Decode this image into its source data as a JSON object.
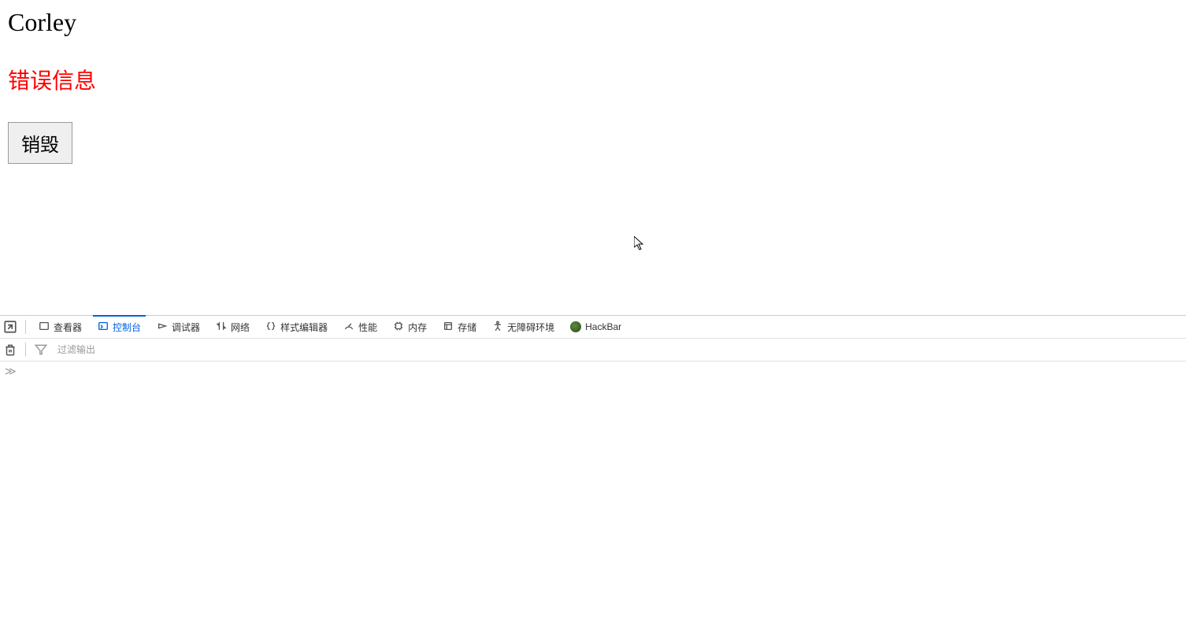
{
  "page": {
    "title": "Corley",
    "error_message": "错误信息",
    "destroy_button": "销毁"
  },
  "devtools": {
    "tabs": [
      {
        "label": "查看器",
        "icon": "inspector"
      },
      {
        "label": "控制台",
        "icon": "console",
        "active": true
      },
      {
        "label": "调试器",
        "icon": "debugger"
      },
      {
        "label": "网络",
        "icon": "network"
      },
      {
        "label": "样式编辑器",
        "icon": "style-editor"
      },
      {
        "label": "性能",
        "icon": "performance"
      },
      {
        "label": "内存",
        "icon": "memory"
      },
      {
        "label": "存储",
        "icon": "storage"
      },
      {
        "label": "无障碍环境",
        "icon": "accessibility"
      },
      {
        "label": "HackBar",
        "icon": "hackbar"
      }
    ],
    "filter_placeholder": "过滤输出"
  }
}
